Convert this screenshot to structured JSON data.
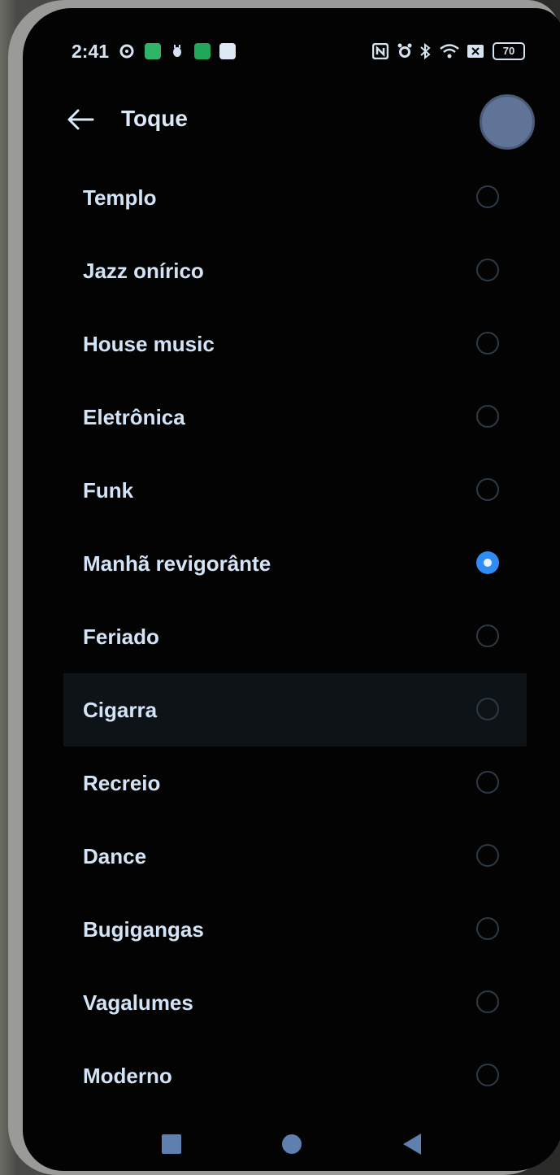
{
  "status_bar": {
    "time": "2:41",
    "battery": "70",
    "left_icons": [
      "settings-gear-icon",
      "green-app-icon",
      "bug-icon",
      "green-app-icon-2",
      "white-app-icon"
    ],
    "right_icons": [
      "nfc-icon",
      "alarm-icon",
      "bluetooth-icon",
      "wifi-icon",
      "sim-icon",
      "battery-icon"
    ]
  },
  "header": {
    "title": "Toque",
    "back_icon": "arrow-left-icon"
  },
  "ringtones": [
    {
      "label": "Templo",
      "selected": false
    },
    {
      "label": "Jazz onírico",
      "selected": false
    },
    {
      "label": "House music",
      "selected": false
    },
    {
      "label": "Eletrônica",
      "selected": false
    },
    {
      "label": "Funk",
      "selected": false
    },
    {
      "label": "Manhã revigorânte",
      "selected": true
    },
    {
      "label": "Feriado",
      "selected": false
    },
    {
      "label": "Cigarra",
      "selected": false
    },
    {
      "label": "Recreio",
      "selected": false
    },
    {
      "label": "Dance",
      "selected": false
    },
    {
      "label": "Bugigangas",
      "selected": false
    },
    {
      "label": "Vagalumes",
      "selected": false
    },
    {
      "label": "Moderno",
      "selected": false
    }
  ],
  "colors": {
    "accent": "#2f8cf5",
    "text": "#d3e4f7",
    "background": "#030303"
  },
  "navbar": {
    "icons": [
      "recents-square-icon",
      "home-circle-icon",
      "back-triangle-icon"
    ]
  }
}
